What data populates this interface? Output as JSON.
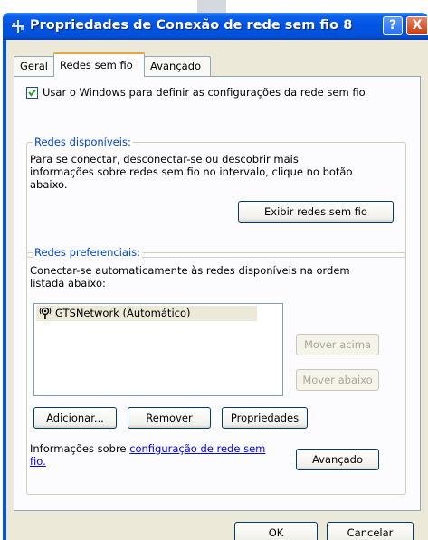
{
  "window": {
    "title": "Propriedades de Conexão de rede sem fio 8",
    "help_label": "?",
    "close_label": "X"
  },
  "tabs": [
    {
      "label": "Geral"
    },
    {
      "label": "Redes sem fio",
      "active": true
    },
    {
      "label": "Avançado"
    }
  ],
  "use_windows_checkbox": {
    "label": "Usar o Windows para definir as configurações da rede sem fio",
    "checked": true
  },
  "available_networks": {
    "legend": "Redes disponíveis:",
    "line1": "Para se conectar, desconectar-se ou descobrir mais",
    "line2": "informações sobre redes sem fio no intervalo, clique no botão",
    "line3": "abaixo.",
    "view_button": "Exibir redes sem fio"
  },
  "preferred_networks": {
    "legend": "Redes preferenciais:",
    "line1": "Conectar-se automaticamente às redes disponíveis na ordem",
    "line2": "listada abaixo:",
    "items": [
      {
        "label": "GTSNetwork (Automático)",
        "icon": "wireless-network-icon"
      }
    ],
    "move_up": "Mover acima",
    "move_down": "Mover abaixo",
    "add": "Adicionar...",
    "remove": "Remover",
    "properties": "Propriedades"
  },
  "info": {
    "prefix": "Informações sobre ",
    "link_line1": "configuração de rede sem",
    "link_line2": "fio.",
    "advanced_button": "Avançado"
  },
  "footer": {
    "ok": "OK",
    "cancel": "Cancelar"
  },
  "colors": {
    "titlebar": "#0054e3",
    "dialog_bg": "#ece9d8",
    "group_legend": "#0046d5",
    "link": "#0000ff"
  }
}
